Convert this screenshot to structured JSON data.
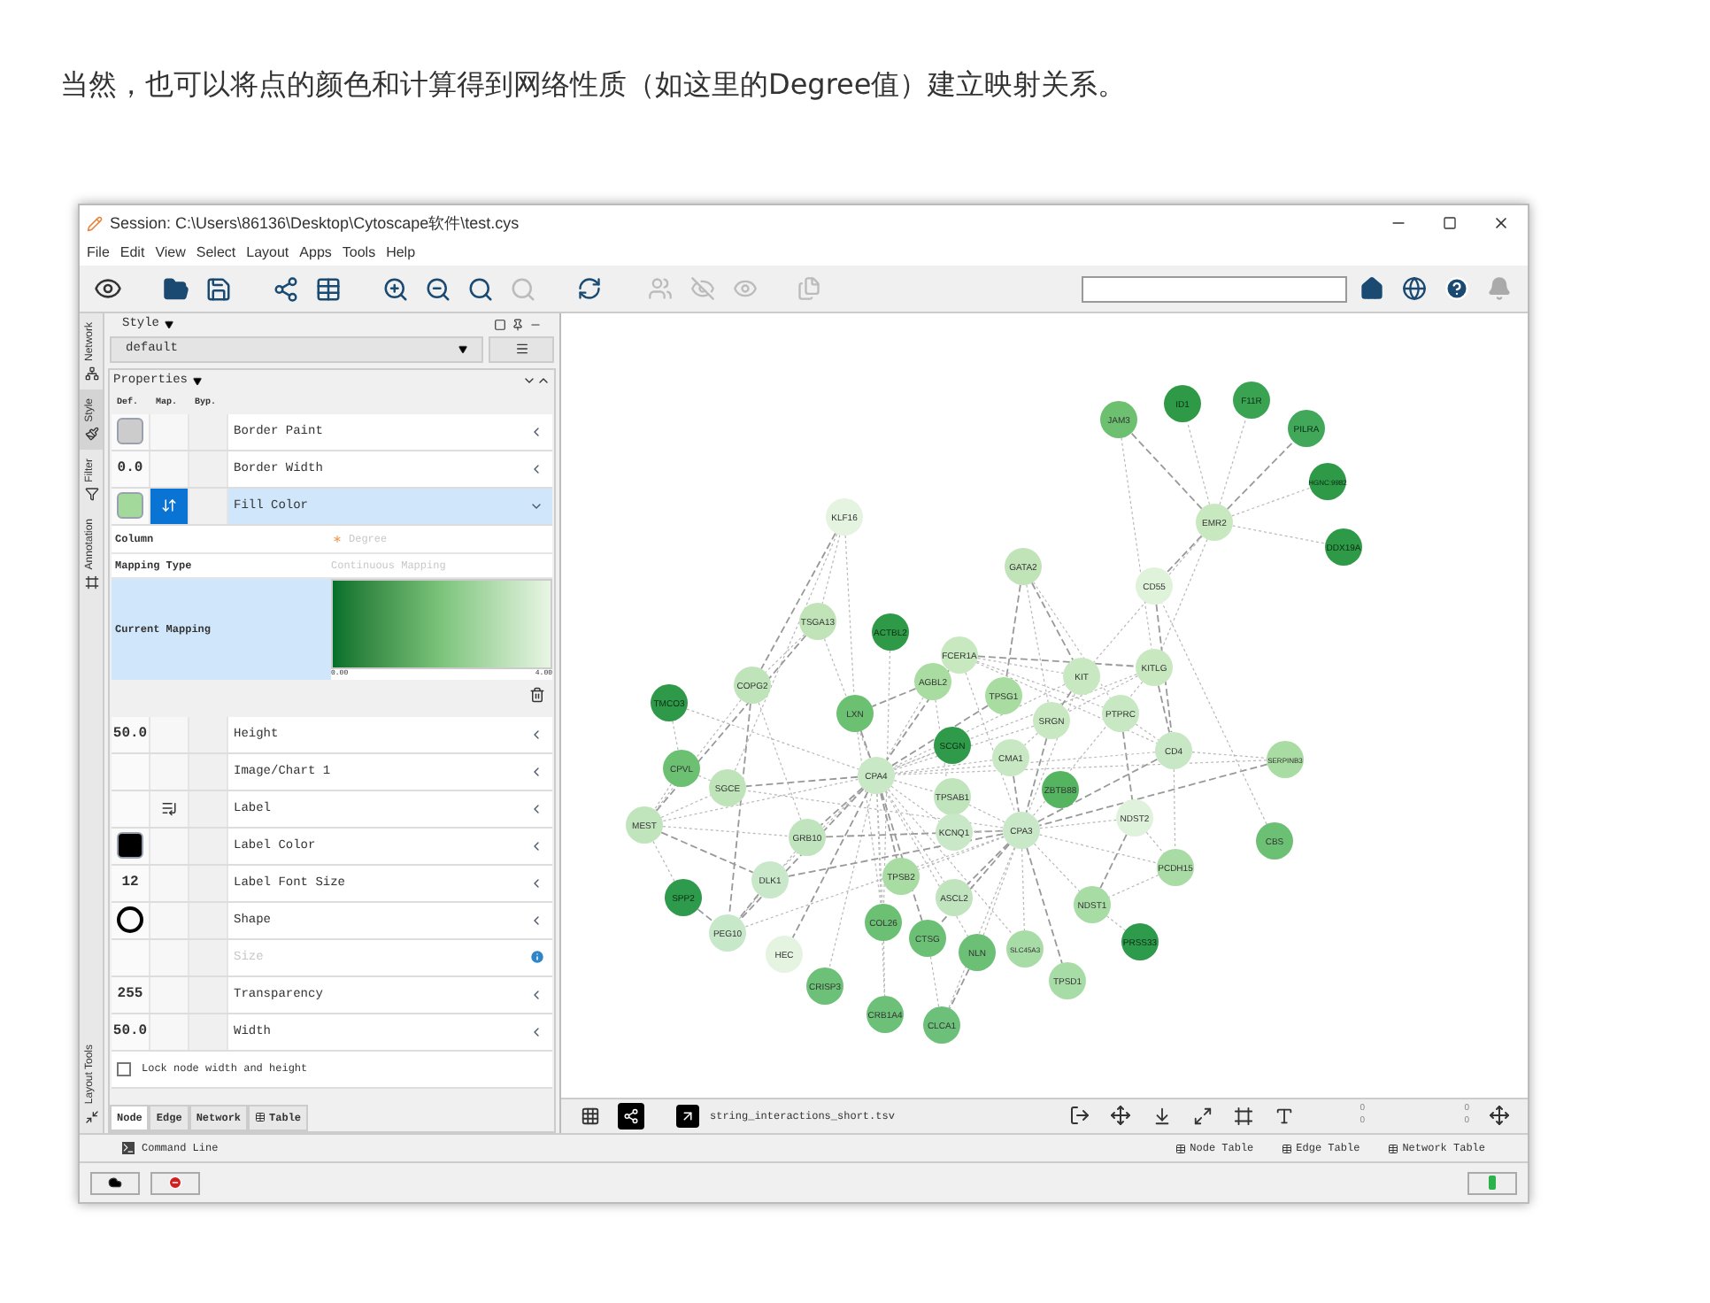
{
  "article_text": "当然，也可以将点的颜色和计算得到网络性质（如这里的Degree值）建立映射关系。",
  "window": {
    "title": "Session: C:\\Users\\86136\\Desktop\\Cytoscape软件\\test.cys",
    "menu": [
      "File",
      "Edit",
      "View",
      "Select",
      "Layout",
      "Apps",
      "Tools",
      "Help"
    ]
  },
  "side_tabs": [
    {
      "label": "Network",
      "selected": false
    },
    {
      "label": "Style",
      "selected": true
    },
    {
      "label": "Filter",
      "selected": false
    },
    {
      "label": "Annotation",
      "selected": false
    },
    {
      "label": "Layout Tools",
      "selected": false
    }
  ],
  "style_panel": {
    "title": "Style",
    "preset": "default",
    "properties_label": "Properties",
    "column_headers": [
      "Def.",
      "Map.",
      "Byp."
    ],
    "properties": [
      {
        "name": "Border Paint",
        "default": {
          "kind": "swatch",
          "color": "#cccccc"
        },
        "expanded": false,
        "disabled": false
      },
      {
        "name": "Border Width",
        "default": {
          "kind": "number",
          "value": "0.0"
        },
        "expanded": false,
        "disabled": false
      },
      {
        "name": "Fill Color",
        "default": {
          "kind": "swatch",
          "color": "#a3d99b"
        },
        "mapping": {
          "kind": "continuous"
        },
        "expanded": true,
        "disabled": false
      }
    ],
    "mapping_detail": {
      "rows": [
        {
          "label": "Column",
          "value": "Degree"
        },
        {
          "label": "Mapping Type",
          "value": "Continuous Mapping"
        }
      ],
      "current_label": "Current Mapping",
      "min": "0.00",
      "max": "4.00"
    },
    "more_properties": [
      {
        "name": "Height",
        "default": {
          "kind": "number",
          "value": "50.0"
        },
        "expanded": false,
        "disabled": false
      },
      {
        "name": "Image/Chart 1",
        "expanded": false,
        "disabled": false
      },
      {
        "name": "Label",
        "mapping": {
          "kind": "passthrough"
        },
        "expanded": false,
        "disabled": false
      },
      {
        "name": "Label Color",
        "default": {
          "kind": "swatch",
          "color": "#000000"
        },
        "expanded": false,
        "disabled": false
      },
      {
        "name": "Label Font Size",
        "default": {
          "kind": "number",
          "value": "12"
        },
        "expanded": false,
        "disabled": false
      },
      {
        "name": "Shape",
        "default": {
          "kind": "ring"
        },
        "expanded": false,
        "disabled": false
      },
      {
        "name": "Size",
        "expanded": false,
        "disabled": true
      },
      {
        "name": "Transparency",
        "default": {
          "kind": "number",
          "value": "255"
        },
        "expanded": false,
        "disabled": false
      },
      {
        "name": "Width",
        "default": {
          "kind": "number",
          "value": "50.0"
        },
        "expanded": false,
        "disabled": false
      }
    ],
    "lock_checkbox": {
      "label": "Lock node width and height",
      "checked": false
    },
    "bottom_tabs": [
      {
        "label": "Node",
        "selected": true
      },
      {
        "label": "Edge",
        "selected": false
      },
      {
        "label": "Network",
        "selected": false
      },
      {
        "label": "Table",
        "selected": false
      }
    ]
  },
  "network": {
    "nodes": [
      {
        "label": "JAM3",
        "color": "#6cc070"
      },
      {
        "label": "ID1",
        "color": "#2e9a48"
      },
      {
        "label": "F11R",
        "color": "#3aa352"
      },
      {
        "label": "PILRA",
        "color": "#41a85a"
      },
      {
        "label": "HGNC:9982",
        "color": "#2e9a48"
      },
      {
        "label": "EMR2",
        "color": "#c8e8c0"
      },
      {
        "label": "DDX19A",
        "color": "#2e9a48"
      },
      {
        "label": "KLF16",
        "color": "#e4f4e0"
      },
      {
        "label": "GATA2",
        "color": "#c0e4b8"
      },
      {
        "label": "CD55",
        "color": "#dff2da"
      },
      {
        "label": "TSGA13",
        "color": "#c0e4b8"
      },
      {
        "label": "ACTBL2",
        "color": "#2e9a48"
      },
      {
        "label": "FCER1A",
        "color": "#c8e8c0"
      },
      {
        "label": "KITLG",
        "color": "#c8e8c0"
      },
      {
        "label": "KIT",
        "color": "#c8e8c1"
      },
      {
        "label": "AGBL2",
        "color": "#a8dca0"
      },
      {
        "label": "TPSG1",
        "color": "#a8dca1"
      },
      {
        "label": "COPG2",
        "color": "#c0e4b9"
      },
      {
        "label": "TMCO3",
        "color": "#2e9a49"
      },
      {
        "label": "LXN",
        "color": "#6cc071"
      },
      {
        "label": "SRGN",
        "color": "#c8e8c2"
      },
      {
        "label": "PTPRC",
        "color": "#c8e8c3"
      },
      {
        "label": "SCGN",
        "color": "#2e9a4a"
      },
      {
        "label": "CMA1",
        "color": "#c8e8c4"
      },
      {
        "label": "CD4",
        "color": "#c8e8c5"
      },
      {
        "label": "SERPINB3",
        "color": "#a8dca2"
      },
      {
        "label": "CPVL",
        "color": "#6cc072"
      },
      {
        "label": "CPA4",
        "color": "#c8e8c6"
      },
      {
        "label": "SGCE",
        "color": "#c0e4ba"
      },
      {
        "label": "ZBTB88",
        "color": "#55b460"
      },
      {
        "label": "TPSAB1",
        "color": "#c0e4bb"
      },
      {
        "label": "MEST",
        "color": "#c0e4bc"
      },
      {
        "label": "GRB10",
        "color": "#c0e4bd"
      },
      {
        "label": "KCNQ1",
        "color": "#c8e8c7"
      },
      {
        "label": "CPA3",
        "color": "#c8e8c8"
      },
      {
        "label": "NDST2",
        "color": "#dff2db"
      },
      {
        "label": "CBS",
        "color": "#6cc073"
      },
      {
        "label": "DLK1",
        "color": "#c8e8c9"
      },
      {
        "label": "TPSB2",
        "color": "#a8dca3"
      },
      {
        "label": "PCDH15",
        "color": "#a8dca4"
      },
      {
        "label": "SPP2",
        "color": "#2e9a4b"
      },
      {
        "label": "ASCL2",
        "color": "#c0e4be"
      },
      {
        "label": "NDST1",
        "color": "#a8dca5"
      },
      {
        "label": "PEG10",
        "color": "#c8e8ca"
      },
      {
        "label": "COL26",
        "color": "#6cc074"
      },
      {
        "label": "CTSG",
        "color": "#6cc075"
      },
      {
        "label": "NLN",
        "color": "#6cc076"
      },
      {
        "label": "SLC45A3",
        "color": "#a8dca6"
      },
      {
        "label": "PRSS33",
        "color": "#2e9a4c"
      },
      {
        "label": "HEC",
        "color": "#e4f4e1"
      },
      {
        "label": "TPSD1",
        "color": "#a8dca7"
      },
      {
        "label": "CRISP3",
        "color": "#6cc077"
      },
      {
        "label": "CRB1A4",
        "color": "#6cc078"
      },
      {
        "label": "CLCA1",
        "color": "#6cc079"
      }
    ]
  },
  "network_toolbar": {
    "file": "string_interactions_short.tsv",
    "counts": [
      "0",
      "0",
      "0",
      "0"
    ]
  },
  "command_line": "Command Line",
  "table_tabs": [
    "Node Table",
    "Edge Table",
    "Network Table"
  ]
}
